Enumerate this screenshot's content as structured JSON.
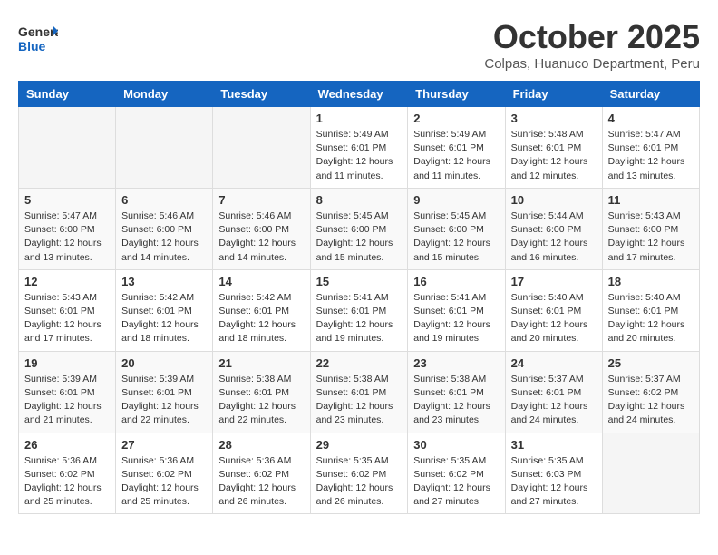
{
  "header": {
    "logo_general": "General",
    "logo_blue": "Blue",
    "month": "October 2025",
    "location": "Colpas, Huanuco Department, Peru"
  },
  "weekdays": [
    "Sunday",
    "Monday",
    "Tuesday",
    "Wednesday",
    "Thursday",
    "Friday",
    "Saturday"
  ],
  "weeks": [
    [
      {
        "day": "",
        "info": ""
      },
      {
        "day": "",
        "info": ""
      },
      {
        "day": "",
        "info": ""
      },
      {
        "day": "1",
        "info": "Sunrise: 5:49 AM\nSunset: 6:01 PM\nDaylight: 12 hours and 11 minutes."
      },
      {
        "day": "2",
        "info": "Sunrise: 5:49 AM\nSunset: 6:01 PM\nDaylight: 12 hours and 11 minutes."
      },
      {
        "day": "3",
        "info": "Sunrise: 5:48 AM\nSunset: 6:01 PM\nDaylight: 12 hours and 12 minutes."
      },
      {
        "day": "4",
        "info": "Sunrise: 5:47 AM\nSunset: 6:01 PM\nDaylight: 12 hours and 13 minutes."
      }
    ],
    [
      {
        "day": "5",
        "info": "Sunrise: 5:47 AM\nSunset: 6:00 PM\nDaylight: 12 hours and 13 minutes."
      },
      {
        "day": "6",
        "info": "Sunrise: 5:46 AM\nSunset: 6:00 PM\nDaylight: 12 hours and 14 minutes."
      },
      {
        "day": "7",
        "info": "Sunrise: 5:46 AM\nSunset: 6:00 PM\nDaylight: 12 hours and 14 minutes."
      },
      {
        "day": "8",
        "info": "Sunrise: 5:45 AM\nSunset: 6:00 PM\nDaylight: 12 hours and 15 minutes."
      },
      {
        "day": "9",
        "info": "Sunrise: 5:45 AM\nSunset: 6:00 PM\nDaylight: 12 hours and 15 minutes."
      },
      {
        "day": "10",
        "info": "Sunrise: 5:44 AM\nSunset: 6:00 PM\nDaylight: 12 hours and 16 minutes."
      },
      {
        "day": "11",
        "info": "Sunrise: 5:43 AM\nSunset: 6:00 PM\nDaylight: 12 hours and 17 minutes."
      }
    ],
    [
      {
        "day": "12",
        "info": "Sunrise: 5:43 AM\nSunset: 6:01 PM\nDaylight: 12 hours and 17 minutes."
      },
      {
        "day": "13",
        "info": "Sunrise: 5:42 AM\nSunset: 6:01 PM\nDaylight: 12 hours and 18 minutes."
      },
      {
        "day": "14",
        "info": "Sunrise: 5:42 AM\nSunset: 6:01 PM\nDaylight: 12 hours and 18 minutes."
      },
      {
        "day": "15",
        "info": "Sunrise: 5:41 AM\nSunset: 6:01 PM\nDaylight: 12 hours and 19 minutes."
      },
      {
        "day": "16",
        "info": "Sunrise: 5:41 AM\nSunset: 6:01 PM\nDaylight: 12 hours and 19 minutes."
      },
      {
        "day": "17",
        "info": "Sunrise: 5:40 AM\nSunset: 6:01 PM\nDaylight: 12 hours and 20 minutes."
      },
      {
        "day": "18",
        "info": "Sunrise: 5:40 AM\nSunset: 6:01 PM\nDaylight: 12 hours and 20 minutes."
      }
    ],
    [
      {
        "day": "19",
        "info": "Sunrise: 5:39 AM\nSunset: 6:01 PM\nDaylight: 12 hours and 21 minutes."
      },
      {
        "day": "20",
        "info": "Sunrise: 5:39 AM\nSunset: 6:01 PM\nDaylight: 12 hours and 22 minutes."
      },
      {
        "day": "21",
        "info": "Sunrise: 5:38 AM\nSunset: 6:01 PM\nDaylight: 12 hours and 22 minutes."
      },
      {
        "day": "22",
        "info": "Sunrise: 5:38 AM\nSunset: 6:01 PM\nDaylight: 12 hours and 23 minutes."
      },
      {
        "day": "23",
        "info": "Sunrise: 5:38 AM\nSunset: 6:01 PM\nDaylight: 12 hours and 23 minutes."
      },
      {
        "day": "24",
        "info": "Sunrise: 5:37 AM\nSunset: 6:01 PM\nDaylight: 12 hours and 24 minutes."
      },
      {
        "day": "25",
        "info": "Sunrise: 5:37 AM\nSunset: 6:02 PM\nDaylight: 12 hours and 24 minutes."
      }
    ],
    [
      {
        "day": "26",
        "info": "Sunrise: 5:36 AM\nSunset: 6:02 PM\nDaylight: 12 hours and 25 minutes."
      },
      {
        "day": "27",
        "info": "Sunrise: 5:36 AM\nSunset: 6:02 PM\nDaylight: 12 hours and 25 minutes."
      },
      {
        "day": "28",
        "info": "Sunrise: 5:36 AM\nSunset: 6:02 PM\nDaylight: 12 hours and 26 minutes."
      },
      {
        "day": "29",
        "info": "Sunrise: 5:35 AM\nSunset: 6:02 PM\nDaylight: 12 hours and 26 minutes."
      },
      {
        "day": "30",
        "info": "Sunrise: 5:35 AM\nSunset: 6:02 PM\nDaylight: 12 hours and 27 minutes."
      },
      {
        "day": "31",
        "info": "Sunrise: 5:35 AM\nSunset: 6:03 PM\nDaylight: 12 hours and 27 minutes."
      },
      {
        "day": "",
        "info": ""
      }
    ]
  ]
}
